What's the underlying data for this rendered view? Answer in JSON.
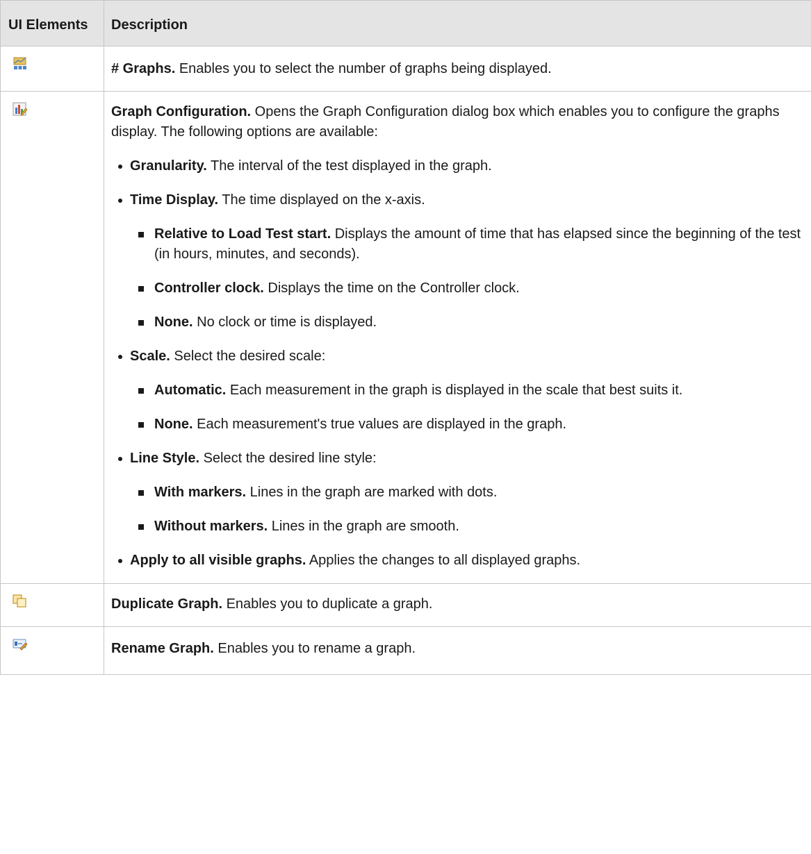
{
  "header": {
    "col1": "UI Elements",
    "col2": "Description"
  },
  "rows": {
    "graphs": {
      "icon": "graphs-layout-icon",
      "term": "# Graphs.",
      "text": " Enables you to select the number of graphs being displayed."
    },
    "config": {
      "icon": "graph-configuration-icon",
      "term": "Graph Configuration.",
      "text": " Opens the Graph Configuration dialog box which enables you to configure the graphs display. The following options are available:",
      "items": [
        {
          "term": "Granularity.",
          "text": " The interval of the test displayed in the graph."
        },
        {
          "term": "Time Display.",
          "text": " The time displayed on the x-axis.",
          "sub": [
            {
              "term": "Relative to Load Test start.",
              "text": " Displays the amount of time that has elapsed since the beginning of the test (in hours, minutes, and seconds)."
            },
            {
              "term": "Controller clock.",
              "text": " Displays the time on the Controller clock."
            },
            {
              "term": "None.",
              "text": " No clock or time is displayed."
            }
          ]
        },
        {
          "term": "Scale.",
          "text": " Select the desired scale:",
          "sub": [
            {
              "term": "Automatic.",
              "text": " Each measurement in the graph is displayed in the scale that best suits it."
            },
            {
              "term": "None.",
              "text": " Each measurement's true values are displayed in the graph."
            }
          ]
        },
        {
          "term": "Line Style.",
          "text": " Select the desired line style:",
          "sub": [
            {
              "term": "With markers.",
              "text": " Lines in the graph are marked with dots."
            },
            {
              "term": "Without markers.",
              "text": " Lines in the graph are smooth."
            }
          ]
        },
        {
          "term": "Apply to all visible graphs.",
          "text": " Applies the changes to all displayed graphs."
        }
      ]
    },
    "duplicate": {
      "icon": "duplicate-graph-icon",
      "term": "Duplicate Graph.",
      "text": " Enables you to duplicate a graph."
    },
    "rename": {
      "icon": "rename-graph-icon",
      "term": "Rename Graph.",
      "text": " Enables you to rename a graph."
    }
  }
}
